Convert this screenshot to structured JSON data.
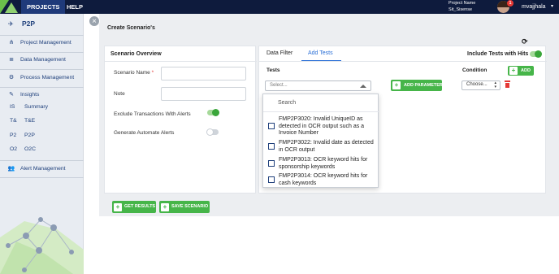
{
  "topbar": {
    "nav": [
      "PROJECTS",
      "HELP"
    ],
    "project_label": "Project Name",
    "project_value": "Sit_Sisense",
    "notification_count": "1",
    "user_name": "mvajjhala",
    "user_caret": "▾"
  },
  "sidebar": {
    "title": "P2P",
    "title_icon": "plane-icon",
    "items": [
      {
        "label": "Project Management",
        "icon": "sitemap-icon",
        "glyph": "⋔"
      },
      {
        "label": "Data Management",
        "icon": "database-icon",
        "glyph": "≣"
      },
      {
        "label": "Process Management",
        "icon": "cogs-icon",
        "glyph": "⚙"
      },
      {
        "label": "Insights",
        "icon": "edit-icon",
        "glyph": "✎"
      },
      {
        "label": "Alert Management",
        "icon": "users-icon",
        "glyph": "👥"
      }
    ],
    "subitems": [
      {
        "abbr": "IS",
        "label": "Summary"
      },
      {
        "abbr": "T&",
        "label": "T&E"
      },
      {
        "abbr": "P2",
        "label": "P2P"
      },
      {
        "abbr": "O2",
        "label": "O2C"
      }
    ]
  },
  "main": {
    "page_title": "Create Scenario's",
    "refresh_icon": "⟳",
    "scenario_overview": {
      "title": "Scenario Overview",
      "name_label": "Scenario Name",
      "required_marker": "*",
      "name_value": "",
      "note_label": "Note",
      "note_value": "",
      "exclude_label": "Exclude Transactions With Alerts",
      "exclude_on": true,
      "automate_label": "Generate Automate Alerts",
      "automate_on": false
    },
    "tabs": [
      {
        "label": "Data Filter",
        "active": false
      },
      {
        "label": "Add Tests",
        "active": true
      }
    ],
    "include_tests_label": "Include Tests with Hits",
    "include_tests_on": true,
    "tests_label": "Tests",
    "tests_placeholder": "Select...",
    "add_parameter_label": "ADD PARAMETER",
    "condition_label": "Condition",
    "condition_value": "Choose...",
    "add_label": "ADD",
    "dropdown": {
      "search_placeholder": "Search",
      "options": [
        "FMP2P3020: Invalid UniqueID as detected in OCR output such as a Invoice Number",
        "FMP2P3022: Invalid date as detected in OCR output",
        "FMP2P3013: OCR keyword hits for sponsorship keywords",
        "FMP2P3014: OCR keyword hits for cash keywords"
      ]
    },
    "get_results_label": "GET RESULTS",
    "save_scenario_label": "SAVE SCENARIO"
  },
  "colors": {
    "topbar": "#0e1b3d",
    "accent_green": "#46b549",
    "tab_blue": "#2a6fd6",
    "sidebar_text": "#1e3f7b"
  }
}
